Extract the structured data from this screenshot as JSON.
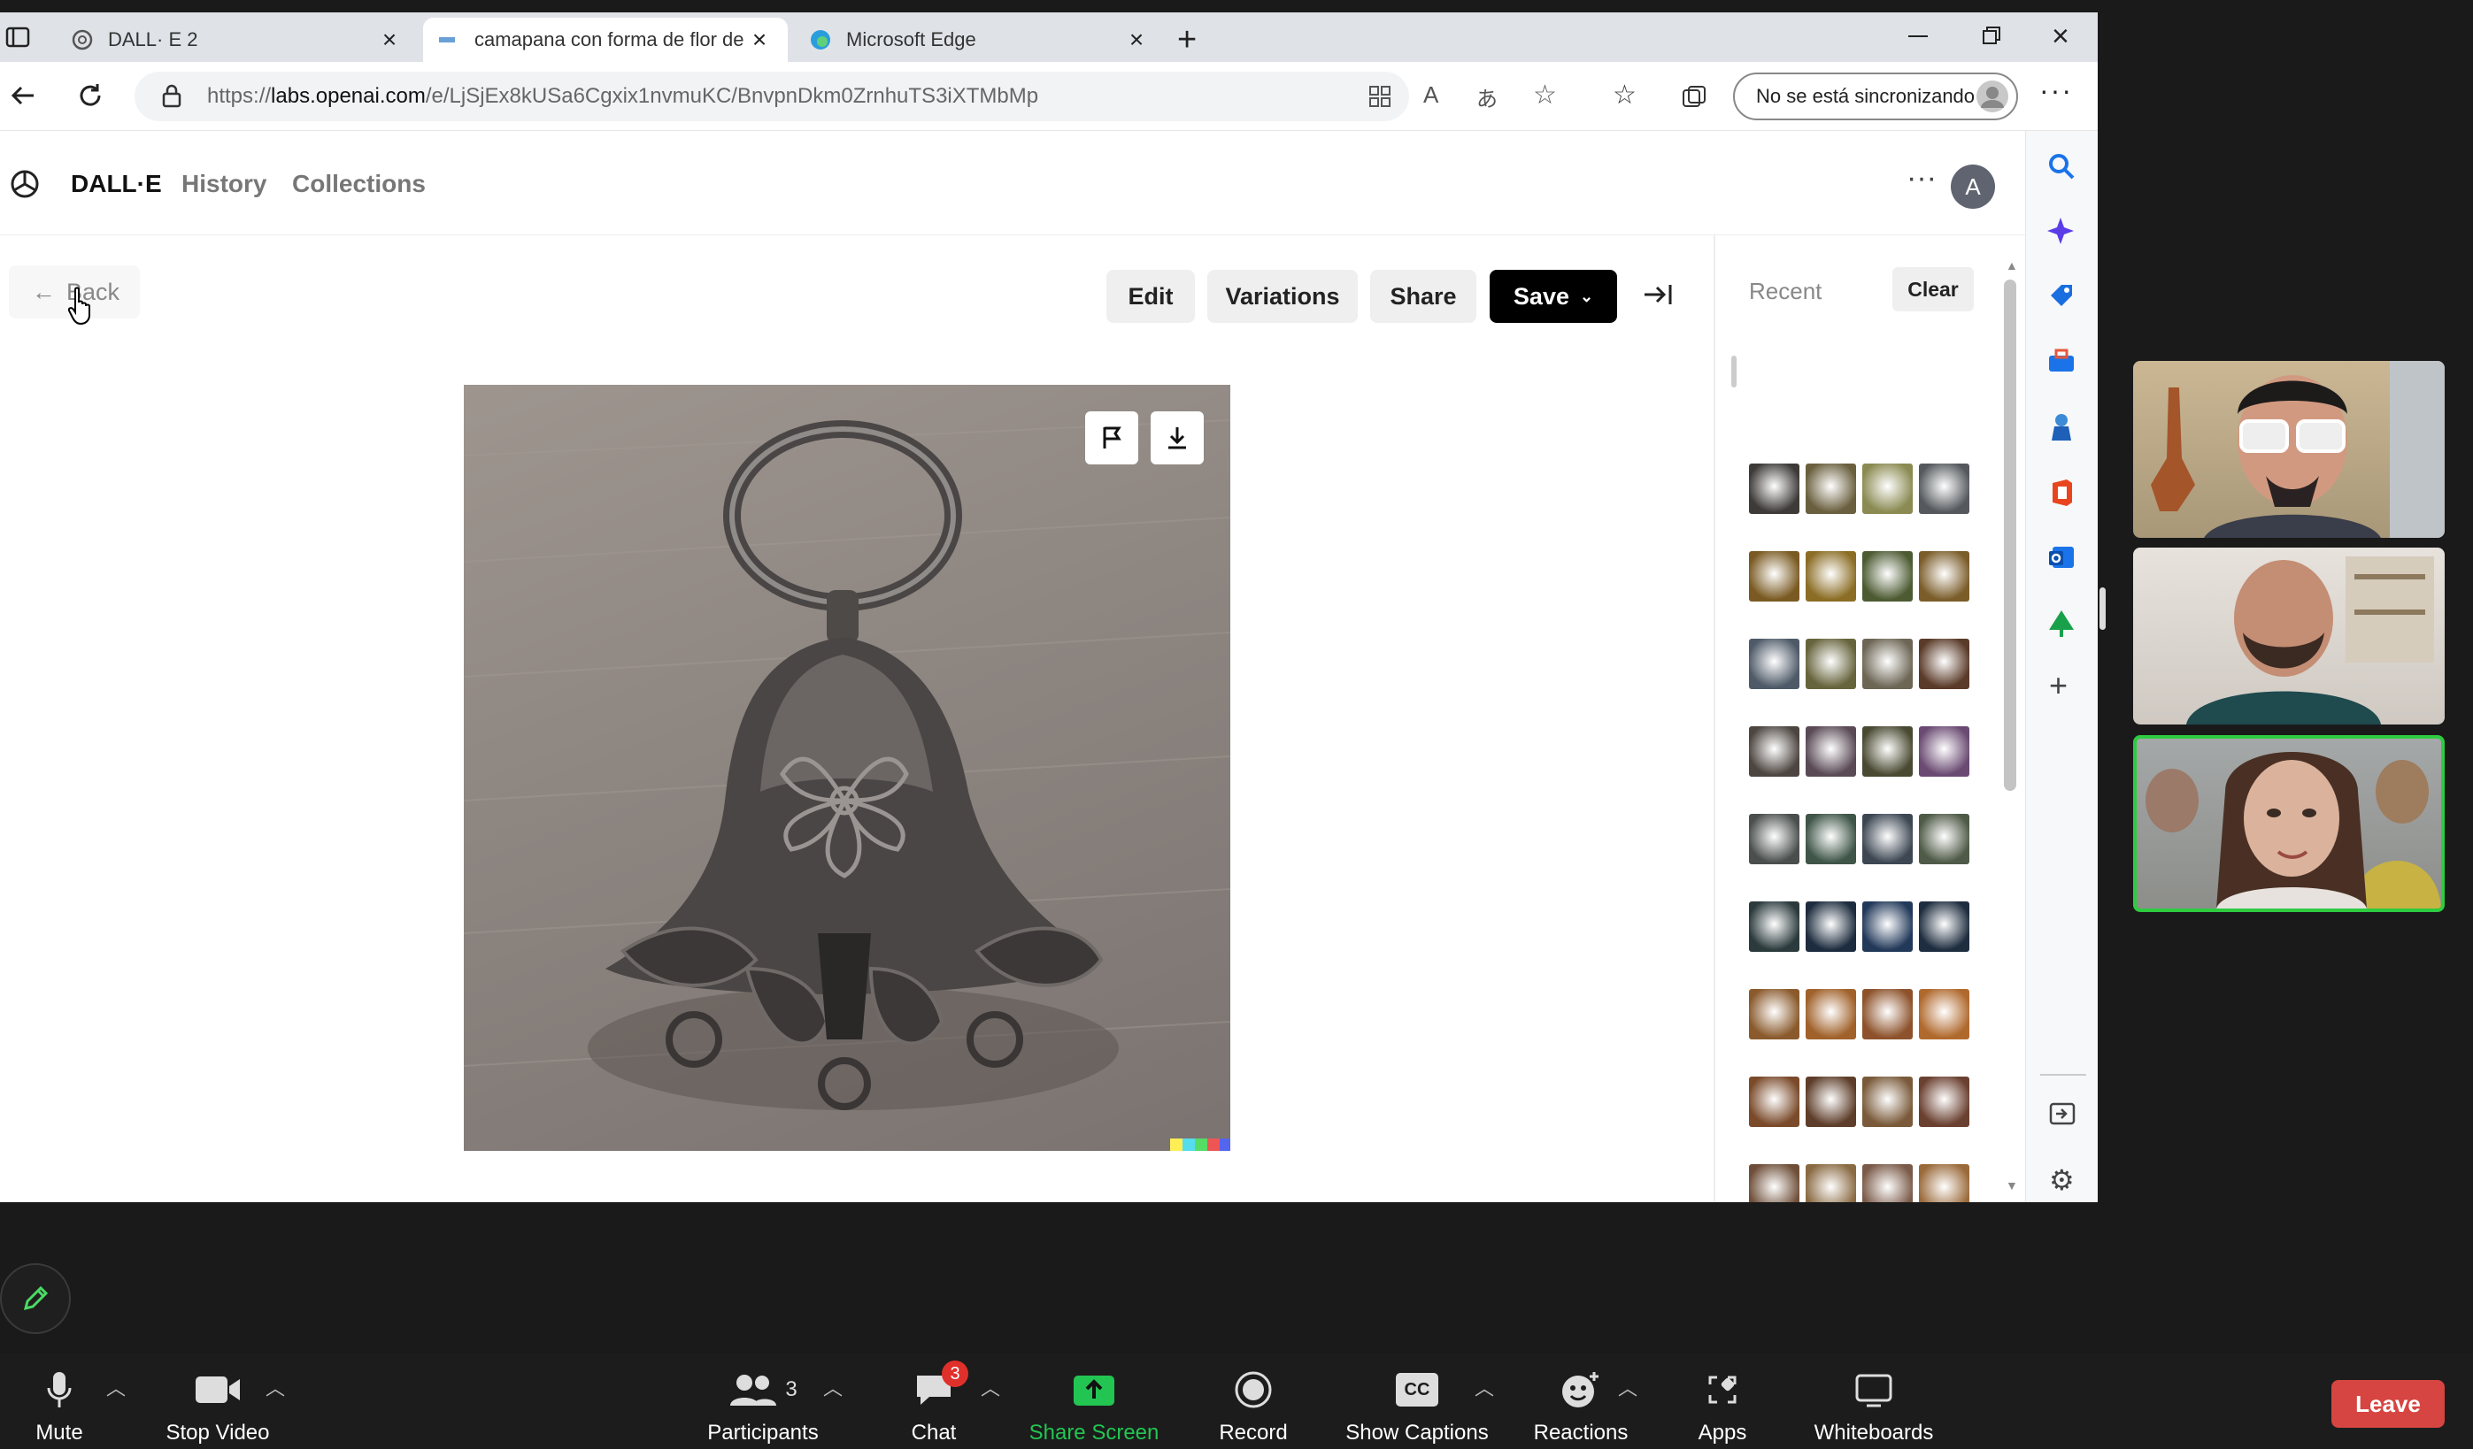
{
  "browser": {
    "tabs": [
      {
        "title": "DALL· E 2",
        "active": false
      },
      {
        "title": "camapana con forma de flor de l",
        "active": true
      },
      {
        "title": "Microsoft Edge",
        "active": false
      }
    ],
    "url_prefix": "https://",
    "url_domain": "labs.openai.com",
    "url_path": "/e/LjSjEx8kUSa6Cgxix1nvmuKC/BnvpnDkm0ZrnhuTS3iXTMbMp",
    "sync_label": "No se está sincronizando"
  },
  "dalle": {
    "brand": "DALL·E",
    "nav": [
      "History",
      "Collections"
    ],
    "avatar_letter": "A",
    "back_label": "Back",
    "actions": {
      "edit": "Edit",
      "variations": "Variations",
      "share": "Share",
      "save": "Save"
    },
    "recent_label": "Recent",
    "clear_label": "Clear",
    "recent_rows": [
      [
        "#3d3a38",
        "#6a5f3e",
        "#8a8a52",
        "#55595d"
      ],
      [
        "#7a5a22",
        "#8b6d25",
        "#4d5b33",
        "#7b5d2a"
      ],
      [
        "#4e5a68",
        "#66643c",
        "#6d6655",
        "#5a3a28"
      ],
      [
        "#4c4540",
        "#5a4a56",
        "#4a4a32",
        "#6a4a72"
      ],
      [
        "#4a4f4d",
        "#3e5548",
        "#3d4753",
        "#4f5a47"
      ],
      [
        "#2b3a3c",
        "#1d2c3e",
        "#22395a",
        "#1e2d3f"
      ],
      [
        "#8a5a2c",
        "#a0612a",
        "#8d522b",
        "#b0692d"
      ],
      [
        "#7a4a2a",
        "#5e3e2a",
        "#7a5a3a",
        "#6a4030"
      ],
      [
        "#6e4e38",
        "#8a6a42",
        "#7a5a48",
        "#9a6a3a"
      ],
      [
        "#5a5a5a",
        "#2e2e2e",
        "#4a4a4a",
        "#8a8a86"
      ]
    ]
  },
  "zoom": {
    "mute": "Mute",
    "stop_video": "Stop Video",
    "participants": "Participants",
    "participants_count": "3",
    "chat": "Chat",
    "chat_badge": "3",
    "share_screen": "Share Screen",
    "record": "Record",
    "show_captions": "Show Captions",
    "cc": "CC",
    "reactions": "Reactions",
    "apps": "Apps",
    "whiteboards": "Whiteboards",
    "leave": "Leave"
  },
  "colors": {
    "active_speaker": "#2ecc40",
    "share_green": "#23c552",
    "leave_red": "#d64541",
    "edge_blue": "#1a73e8"
  }
}
